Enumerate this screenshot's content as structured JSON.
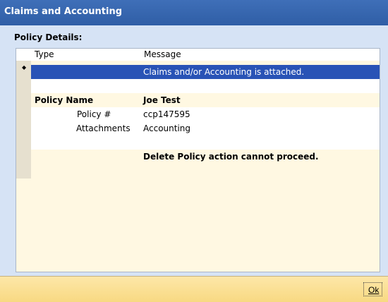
{
  "window": {
    "title": "Claims and Accounting"
  },
  "section": {
    "label": "Policy Details:"
  },
  "grid": {
    "columns": [
      "Type",
      "Message"
    ],
    "selected_row": {
      "type": "",
      "message": "Claims and/or Accounting is attached."
    },
    "policy_name_label": "Policy Name",
    "policy_name_value": "Joe Test",
    "policy_number_label": "Policy #",
    "policy_number_value": "ccp147595",
    "attachments_label": "Attachments",
    "attachments_value": "Accounting",
    "error_message": "Delete Policy action cannot proceed.",
    "row_marker": "◆"
  },
  "footer": {
    "ok_label": "Ok"
  }
}
